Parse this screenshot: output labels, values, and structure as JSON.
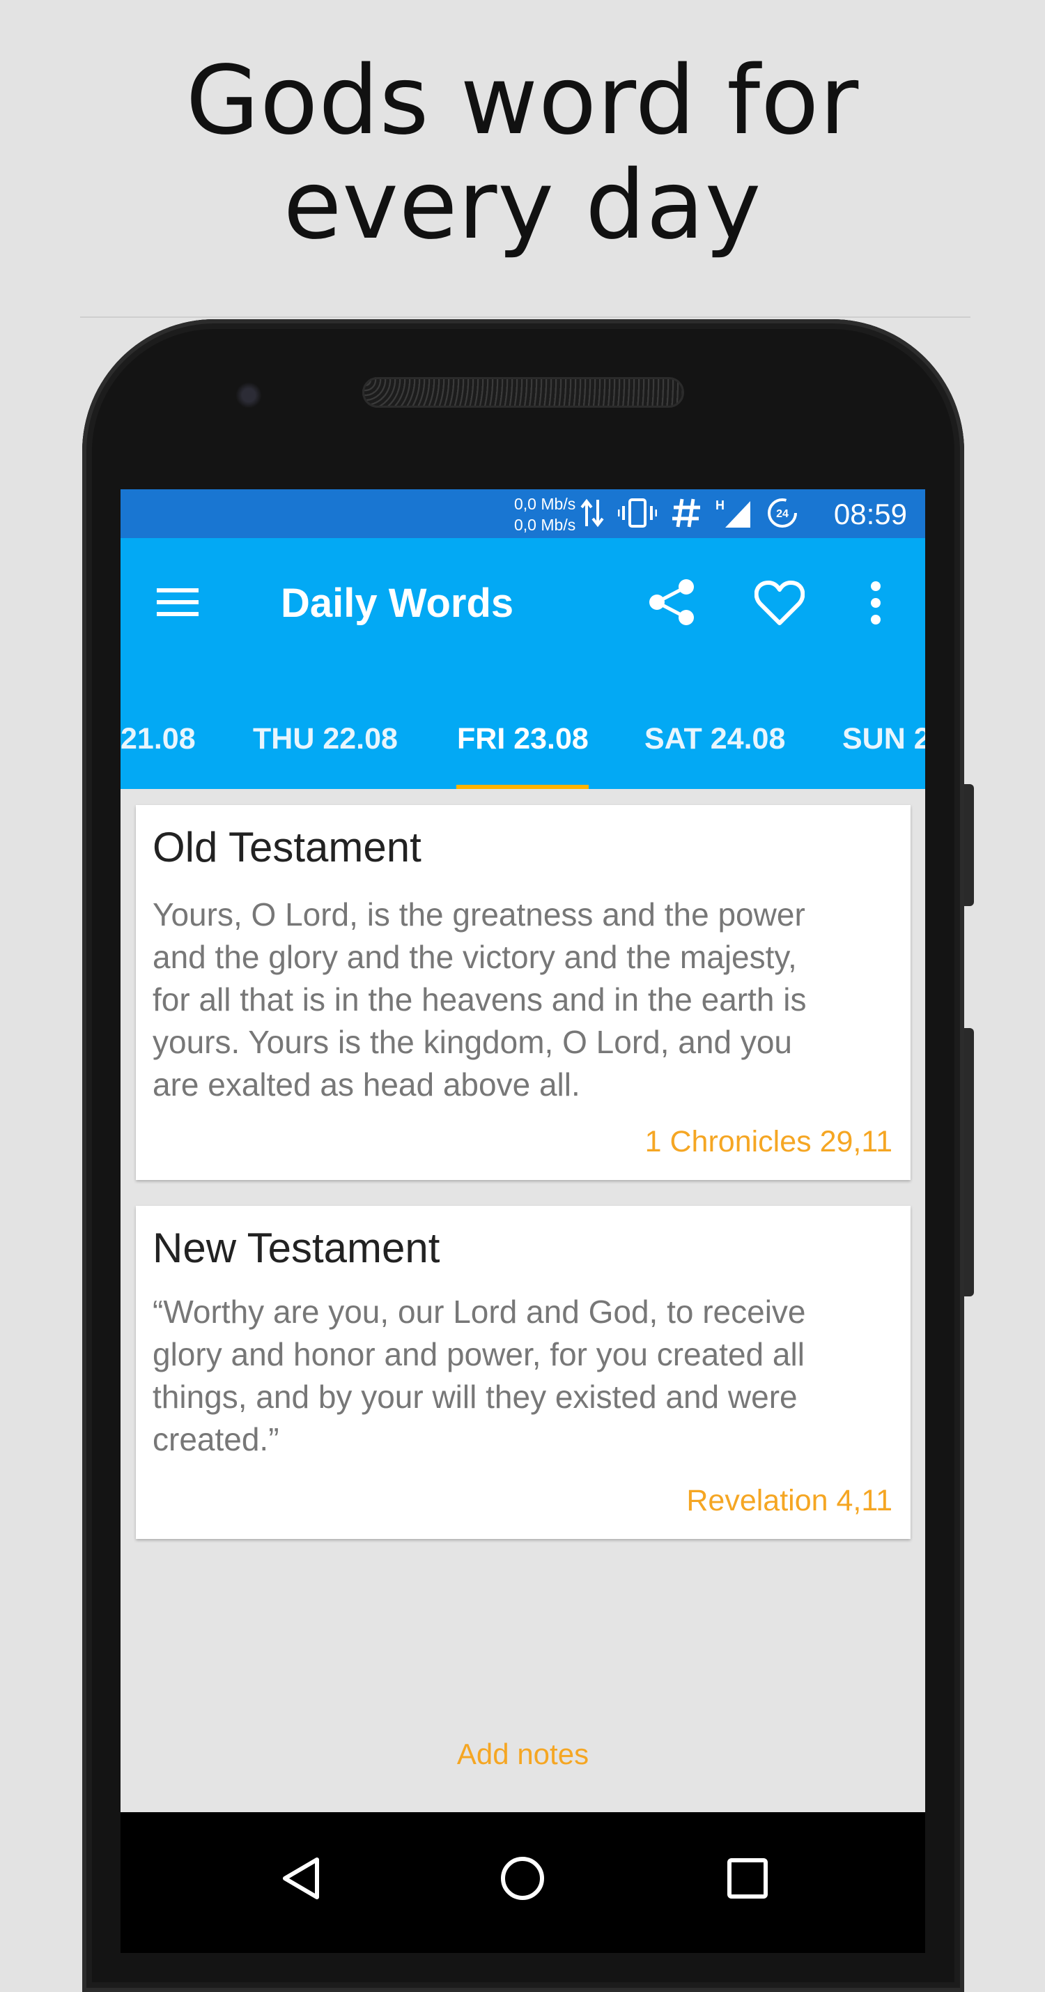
{
  "headline": {
    "line1": "Gods word for",
    "line2": "every day"
  },
  "status_bar": {
    "net_up": "0,0 Mb/s",
    "net_down": "0,0 Mb/s",
    "network_type": "H",
    "time": "08:59",
    "badge": "24"
  },
  "app_bar": {
    "title": "Daily Words"
  },
  "tabs": [
    {
      "label": "21.08",
      "selected": false
    },
    {
      "label": "THU 22.08",
      "selected": false
    },
    {
      "label": "FRI 23.08",
      "selected": true
    },
    {
      "label": "SAT 24.08",
      "selected": false
    },
    {
      "label": "SUN 2",
      "selected": false
    }
  ],
  "cards": [
    {
      "title": "Old Testament",
      "text_lines": [
        "Yours, O Lord, is the greatness and the power",
        "and the glory and the victory and the majesty,",
        "for all that is in the heavens and in the earth is",
        "yours. Yours is the kingdom, O Lord, and you",
        "are exalted as head above all."
      ],
      "reference": "1 Chronicles 29,11"
    },
    {
      "title": "New Testament",
      "text_lines": [
        "“Worthy are you, our Lord and God, to receive",
        "glory and honor and power, for you created all",
        "things, and by your will they existed and were",
        "created.”"
      ],
      "reference": "Revelation 4,11"
    }
  ],
  "add_notes_label": "Add notes",
  "colors": {
    "status_bar": "#1976d2",
    "app_bar": "#03a9f4",
    "accent": "#f5a623",
    "tab_indicator": "#ffb300"
  },
  "icons": [
    "menu-icon",
    "share-icon",
    "heart-icon",
    "more-vert-icon",
    "back-icon",
    "home-icon",
    "recents-icon"
  ]
}
